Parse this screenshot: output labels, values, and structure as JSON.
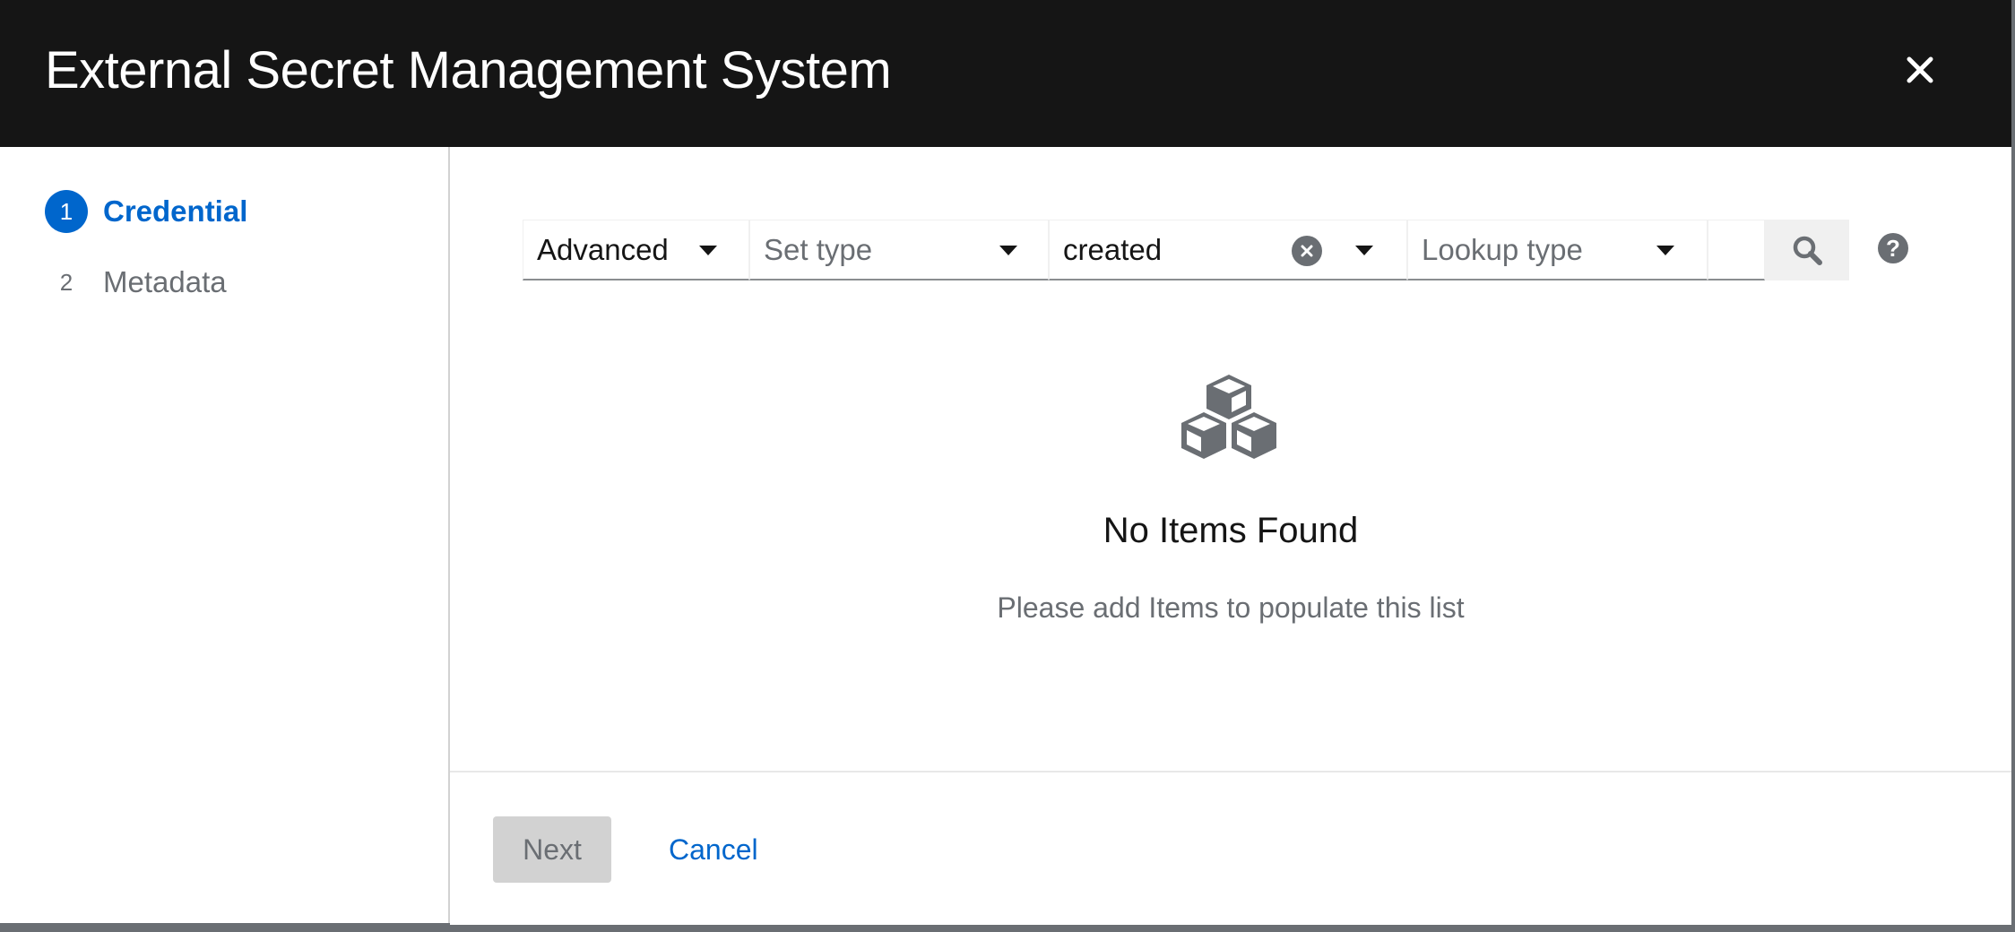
{
  "modal": {
    "title": "External Secret Management System"
  },
  "wizard_nav": {
    "steps": [
      {
        "number": "1",
        "label": "Credential",
        "active": true
      },
      {
        "number": "2",
        "label": "Metadata",
        "active": false
      }
    ]
  },
  "toolbar": {
    "search_mode": "Advanced",
    "set_type_placeholder": "Set type",
    "key_value": "created",
    "lookup_type_placeholder": "Lookup type",
    "search_input_value": ""
  },
  "empty_state": {
    "title": "No Items Found",
    "body": "Please add Items to populate this list"
  },
  "footer": {
    "next_label": "Next",
    "cancel_label": "Cancel"
  },
  "colors": {
    "header_bg": "#151515",
    "accent": "#0066cc",
    "muted_text": "#6a6e73",
    "disabled_button": "#d2d2d2"
  },
  "icons": {
    "close": "close-icon",
    "caret": "caret-down-icon",
    "clear": "times-circle-icon",
    "search": "search-icon",
    "help": "question-circle-icon",
    "empty": "cubes-icon"
  }
}
